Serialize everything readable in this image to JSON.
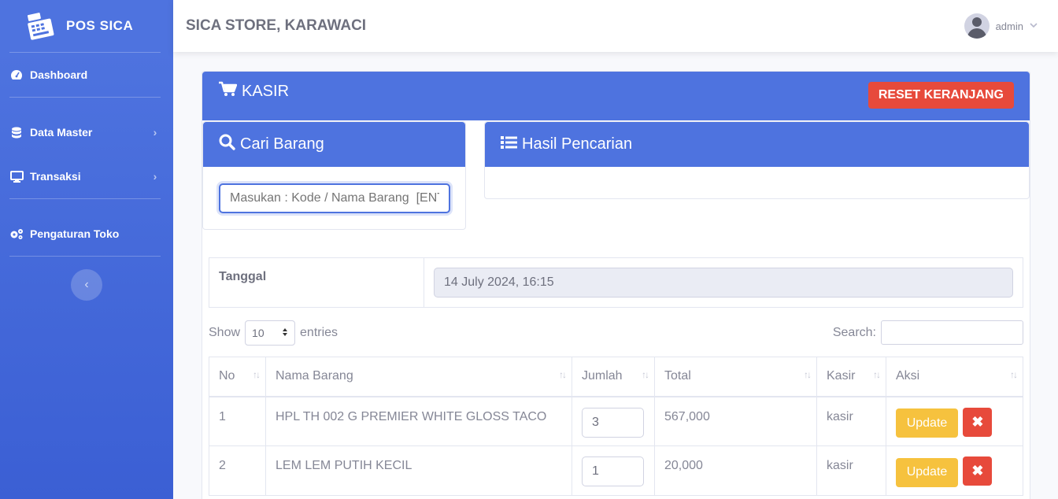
{
  "brand": {
    "name": "POS SICA",
    "icon": "cash-register-icon"
  },
  "sidebar": {
    "items": [
      {
        "label": "Dashboard",
        "icon": "tachometer-icon"
      },
      {
        "label": "Data Master",
        "icon": "database-icon",
        "chevron": "›"
      },
      {
        "label": "Transaksi",
        "icon": "desktop-icon",
        "chevron": "›"
      },
      {
        "label": "Pengaturan Toko",
        "icon": "cogs-icon"
      }
    ],
    "toggle": "‹"
  },
  "topbar": {
    "store": "SICA STORE, KARAWACI",
    "user": "admin"
  },
  "kasir": {
    "title": "KASIR",
    "reset_label": "RESET KERANJANG",
    "cari_title": "Cari Barang",
    "search_placeholder": "Masukan : Kode / Nama Barang  [ENTER]",
    "hasil_title": "Hasil Pencarian",
    "tanggal_label": "Tanggal",
    "tanggal_value": "14 July 2024, 16:15"
  },
  "datatable": {
    "show_label": "Show",
    "entries_value": "10",
    "entries_label": "entries",
    "search_label": "Search:",
    "columns": [
      "No",
      "Nama Barang",
      "Jumlah",
      "Total",
      "Kasir",
      "Aksi"
    ],
    "rows": [
      {
        "no": "1",
        "nama": "HPL TH 002 G PREMIER WHITE GLOSS TACO",
        "jumlah": "3",
        "total": "567,000",
        "kasir": "kasir"
      },
      {
        "no": "2",
        "nama": "LEM LEM PUTIH KECIL",
        "jumlah": "1",
        "total": "20,000",
        "kasir": "kasir"
      }
    ],
    "update_label": "Update",
    "delete_label": "✖"
  },
  "colors": {
    "primary": "#4e73df",
    "danger": "#e74a3b",
    "warning": "#f6c23e"
  }
}
